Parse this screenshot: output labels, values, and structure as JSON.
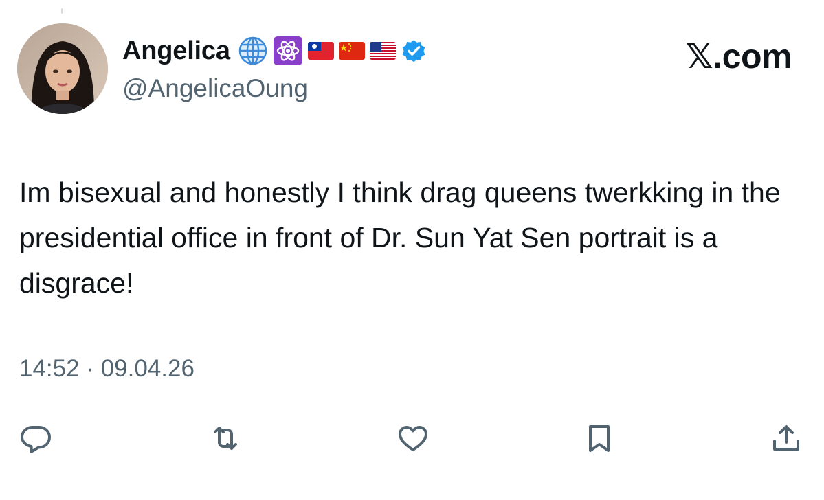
{
  "author": {
    "display_name": "Angelica",
    "handle": "@AngelicaOung",
    "badges": [
      "globe-emoji",
      "atom-symbol-emoji",
      "flag-taiwan",
      "flag-china",
      "flag-usa",
      "verified-badge"
    ]
  },
  "brand": {
    "label": "𝕏.com"
  },
  "tweet": {
    "text": "Im bisexual and honestly I think drag queens twerkking in the presidential office in front of Dr. Sun Yat Sen portrait is a disgrace!",
    "timestamp": "14:52 · 09.04.26"
  },
  "actions": [
    "reply-icon",
    "repost-icon",
    "like-icon",
    "bookmark-icon",
    "share-icon"
  ],
  "colors": {
    "text_primary": "#0f1419",
    "text_secondary": "#536471",
    "verified_blue": "#1d9bf0",
    "atom_badge_purple": "#8a3fc9"
  }
}
